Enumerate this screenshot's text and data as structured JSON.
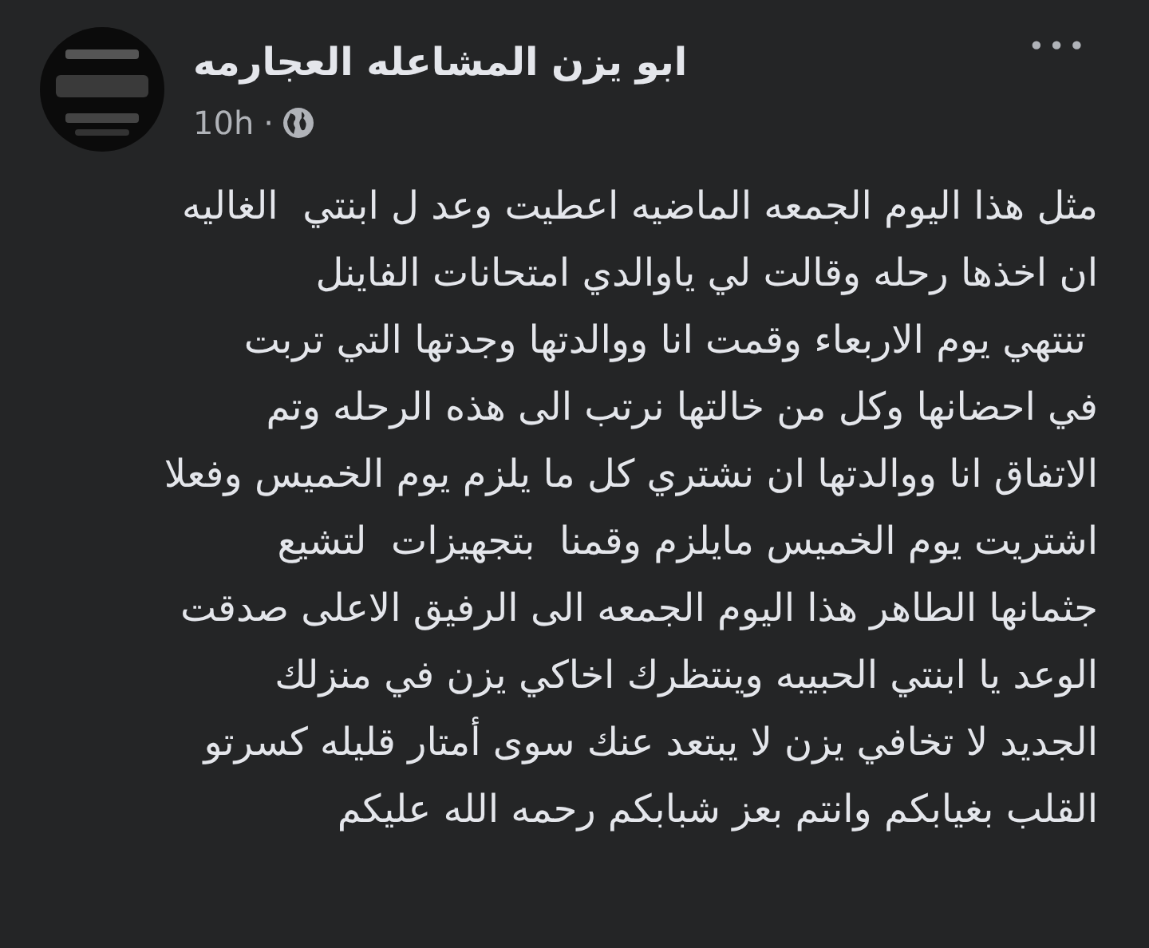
{
  "post": {
    "author": "ابو يزن المشاعله العجارمه",
    "time": "10h",
    "separator": "·",
    "more": "•••",
    "text": "مثل هذا اليوم الجمعه الماضيه اعطيت وعد ل ابنتي  الغاليه\nان اخذها رحله وقالت لي ياوالدي امتحانات الفاينل\n تنتهي يوم الاربعاء وقمت انا ووالدتها وجدتها التي تربت\nفي احضانها وكل من خالتها نرتب الى هذه الرحله وتم\nالاتفاق انا ووالدتها ان نشتري كل ما يلزم يوم الخميس وفعلا\nاشتريت يوم الخميس مايلزم وقمنا  بتجهيزات  لتشيع\nجثمانها الطاهر هذا اليوم الجمعه الى الرفيق الاعلى صدقت\nالوعد يا ابنتي الحبيبه وينتظرك اخاكي يزن في منزلك\nالجديد لا تخافي يزن لا يبتعد عنك سوى أمتار قليله كسرتو\nالقلب بغيابكم وانتم بعز شبابكم رحمه الله عليكم"
  }
}
